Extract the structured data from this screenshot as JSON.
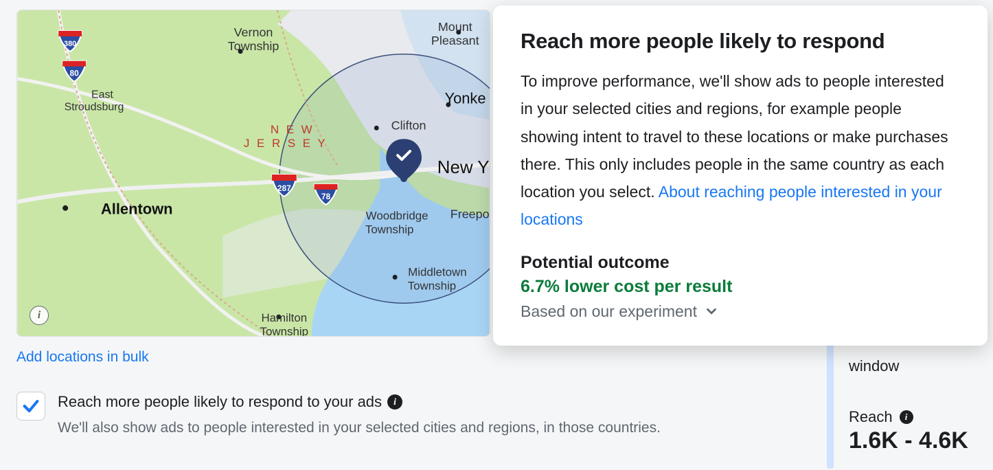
{
  "map": {
    "places": {
      "vernon_township": "Vernon Township",
      "mount_pleasant": "Mount Pleasant",
      "east_stroudsburg": "East Stroudsburg",
      "new_jersey": "N E W\nJ E R S E Y",
      "clifton": "Clifton",
      "yonkers": "Yonke",
      "new_york": "New Y",
      "allentown": "Allentown",
      "woodbridge_township": "Woodbridge Township",
      "freeport": "Freepo",
      "middletown_township": "Middletown Township",
      "hamilton_township": "Hamilton Township"
    },
    "shields": {
      "i380": "380",
      "i80": "80",
      "i287": "287",
      "i78": "78"
    }
  },
  "bulk_link": "Add locations in bulk",
  "checkbox": {
    "title": "Reach more people likely to respond to your ads",
    "description": "We'll also show ads to people interested in your selected cities and regions, in those countries."
  },
  "popover": {
    "title": "Reach more people likely to respond",
    "body": "To improve performance, we'll show ads to people interested in your selected cities and regions, for example people showing intent to travel to these locations or make purchases there. This only includes people in the same country as each location you select. ",
    "link": "About reaching people interested in your locations",
    "outcome_title": "Potential outcome",
    "outcome_value": "6.7% lower cost per result",
    "outcome_note": "Based on our experiment"
  },
  "side": {
    "window": "window",
    "reach": "Reach",
    "num": "1.6K - 4.6K"
  }
}
